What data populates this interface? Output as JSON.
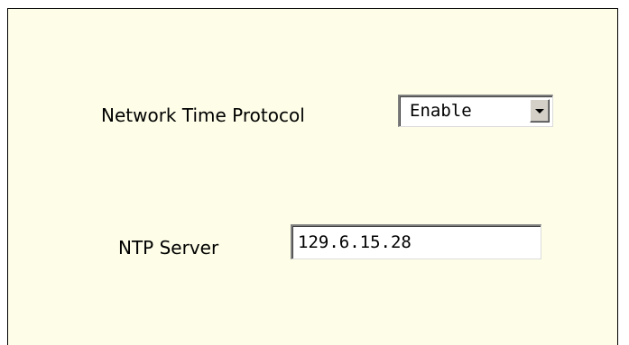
{
  "form": {
    "ntp_label": "Network Time Protocol",
    "ntp_select": {
      "selected": "Enable"
    },
    "server_label": "NTP Server",
    "server_input": {
      "value": "129.6.15.28"
    }
  }
}
